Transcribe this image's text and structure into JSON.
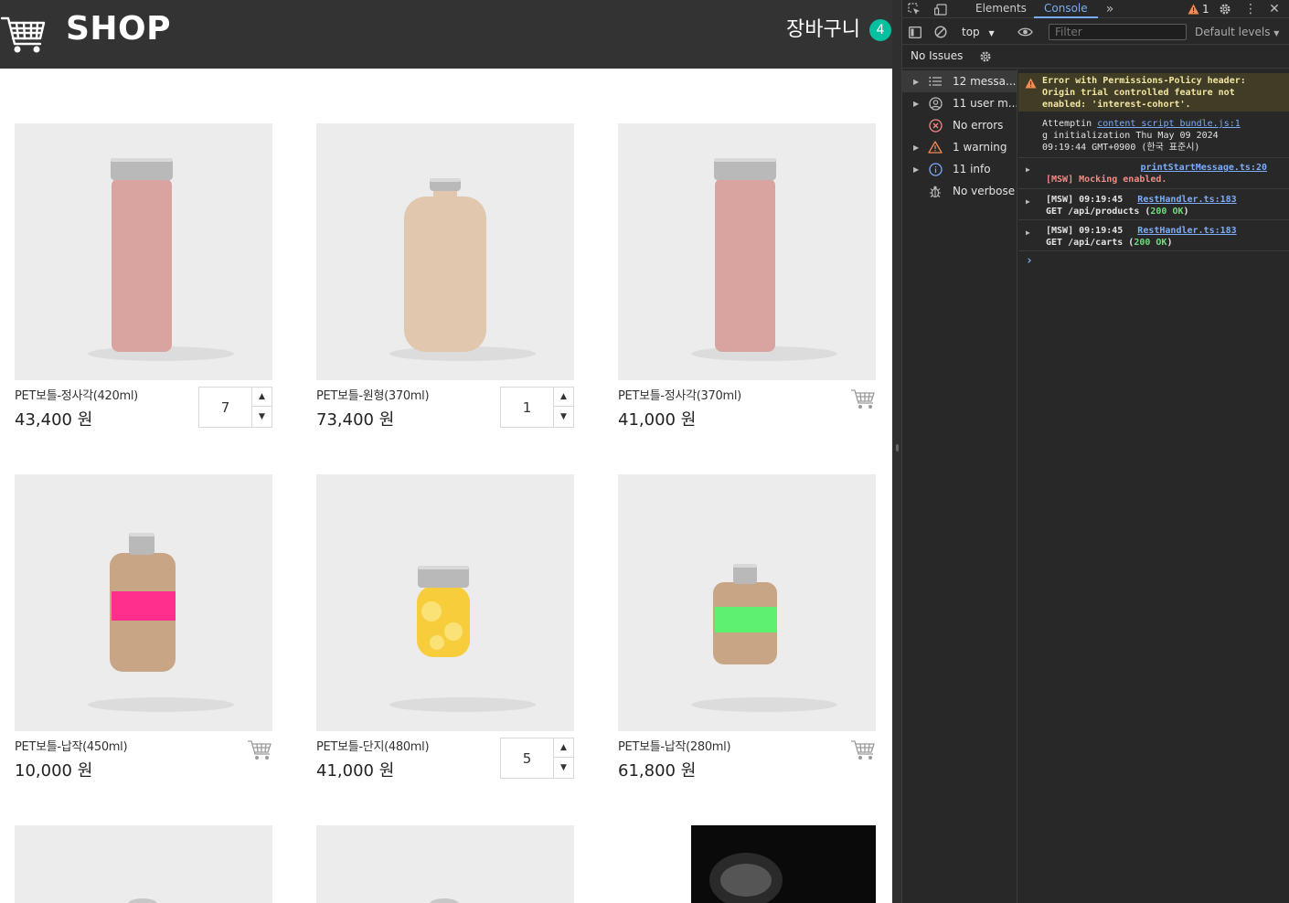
{
  "shop": {
    "title": "SHOP",
    "cart_label": "장바구니",
    "cart_count": "4",
    "products": [
      {
        "name": "PET보틀-정사각(420ml)",
        "price": "43,400 원",
        "quantity": "7",
        "image": "pink-square-bottle",
        "in_cart": true
      },
      {
        "name": "PET보틀-원형(370ml)",
        "price": "73,400 원",
        "quantity": "1",
        "image": "beige-round-bottle",
        "in_cart": true
      },
      {
        "name": "PET보틀-정사각(370ml)",
        "price": "41,000 원",
        "quantity": null,
        "image": "pink-square-bottle",
        "in_cart": false
      },
      {
        "name": "PET보틀-납작(450ml)",
        "price": "10,000 원",
        "quantity": null,
        "image": "beige-flask-pink-band",
        "in_cart": false
      },
      {
        "name": "PET보틀-단지(480ml)",
        "price": "41,000 원",
        "quantity": "5",
        "image": "lemon-jar",
        "in_cart": true
      },
      {
        "name": "PET보틀-납작(280ml)",
        "price": "61,800 원",
        "quantity": null,
        "image": "beige-flask-green-band",
        "in_cart": false
      }
    ]
  },
  "devtools": {
    "tabs": [
      "Elements",
      "Console"
    ],
    "active_tab": "Console",
    "warning_count": "1",
    "context": "top",
    "filter_placeholder": "Filter",
    "levels": "Default levels",
    "issues": "No Issues",
    "sidebar": [
      {
        "label": "12 messa...",
        "icon": "list-icon",
        "expandable": true
      },
      {
        "label": "11 user m...",
        "icon": "user-icon",
        "expandable": true
      },
      {
        "label": "No errors",
        "icon": "error-icon",
        "expandable": false
      },
      {
        "label": "1 warning",
        "icon": "warning-icon",
        "expandable": true
      },
      {
        "label": "11 info",
        "icon": "info-icon",
        "expandable": true
      },
      {
        "label": "No verbose",
        "icon": "bug-icon",
        "expandable": false
      }
    ],
    "console": {
      "warning_lines": [
        "Error with Permissions-Policy header:",
        "Origin trial controlled feature not",
        "enabled: 'interest-cohort'."
      ],
      "init_source": "content script bundle.js:1",
      "init_line1": "Attemptin",
      "init_line2": "g initialization Thu May 09 2024",
      "init_line3": "09:19:44 GMT+0900 (한국 표준시)",
      "msw_source": "printStartMessage.ts:20",
      "msw_text": "[MSW] Mocking enabled.",
      "req1_prefix": "[MSW] 09:19:45",
      "req1_source": "RestHandler.ts:183",
      "req1_method": "GET /api/products (",
      "req1_status": "200 OK",
      "req2_prefix": "[MSW] 09:19:45",
      "req2_source": "RestHandler.ts:183",
      "req2_method": "GET /api/carts (",
      "req2_status": "200 OK",
      "close_paren": ")"
    }
  },
  "colors": {
    "header_bg": "#333333",
    "badge": "#04c09e",
    "devtools_bg": "#282828",
    "accent": "#7cacf8"
  }
}
